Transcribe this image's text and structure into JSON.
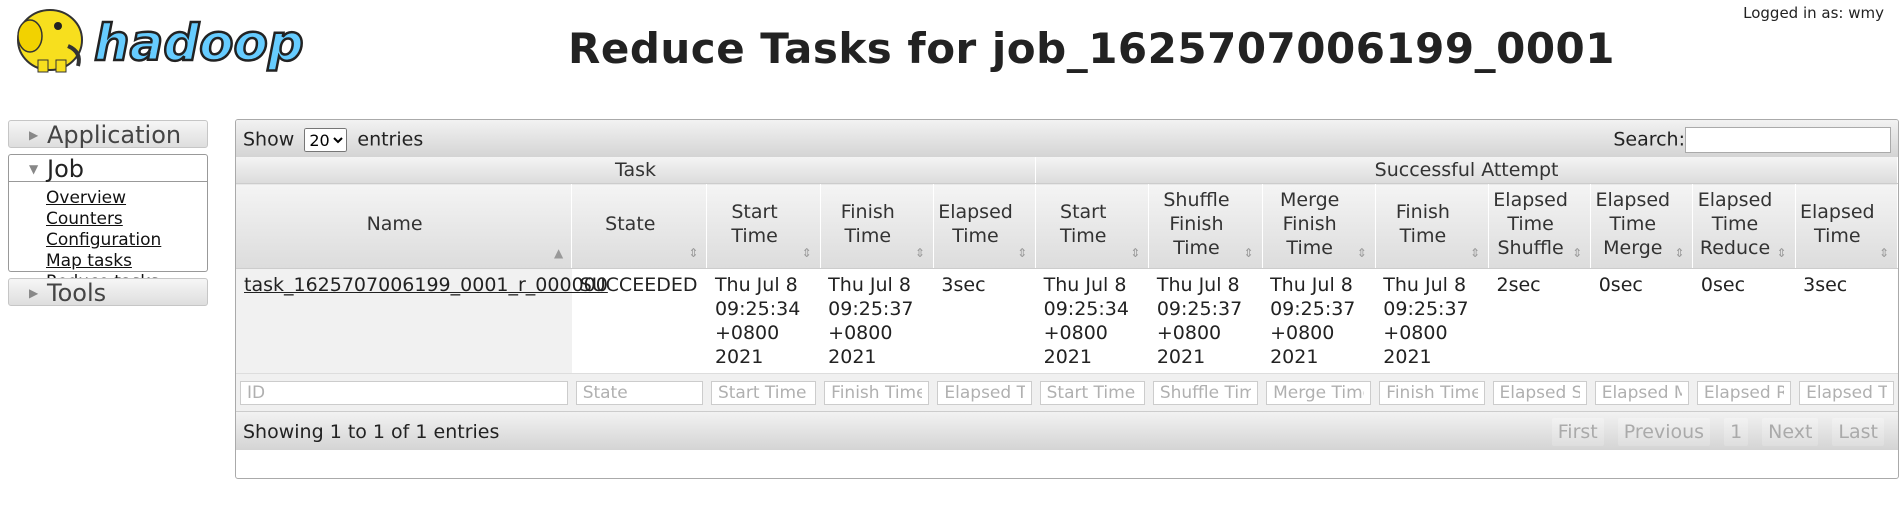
{
  "header": {
    "logo_text": "hadoop",
    "title": "Reduce Tasks for job_1625707006199_0001",
    "login": "Logged in as: wmy"
  },
  "nav": {
    "application": "Application",
    "job": "Job",
    "tools": "Tools",
    "job_links": [
      "Overview",
      "Counters",
      "Configuration",
      "Map tasks",
      "Reduce tasks"
    ]
  },
  "table": {
    "show_label": "Show",
    "entries_label": "entries",
    "page_size": "20",
    "search_label": "Search:",
    "groups": [
      "Task",
      "Successful Attempt"
    ],
    "columns": [
      "Name",
      "State",
      "Start Time",
      "Finish Time",
      "Elapsed Time",
      "Start Time",
      "Shuffle Finish Time",
      "Merge Finish Time",
      "Finish Time",
      "Elapsed Time Shuffle",
      "Elapsed Time Merge",
      "Elapsed Time Reduce",
      "Elapsed Time"
    ],
    "rows": [
      [
        "task_1625707006199_0001_r_000000",
        "SUCCEEDED",
        "Thu Jul 8 09:25:34 +0800 2021",
        "Thu Jul 8 09:25:37 +0800 2021",
        "3sec",
        "Thu Jul 8 09:25:34 +0800 2021",
        "Thu Jul 8 09:25:37 +0800 2021",
        "Thu Jul 8 09:25:37 +0800 2021",
        "Thu Jul 8 09:25:37 +0800 2021",
        "2sec",
        "0sec",
        "0sec",
        "3sec"
      ]
    ],
    "filters": [
      "ID",
      "State",
      "Start Time",
      "Finish Time",
      "Elapsed Time",
      "Start Time",
      "Shuffle Time",
      "Merge Time",
      "Finish Time",
      "Elapsed Shuffle Time",
      "Elapsed Merge Time",
      "Elapsed Reduce Time",
      "Elapsed Time"
    ],
    "info": "Showing 1 to 1 of 1 entries",
    "pager": [
      "First",
      "Previous",
      "1",
      "Next",
      "Last"
    ]
  }
}
